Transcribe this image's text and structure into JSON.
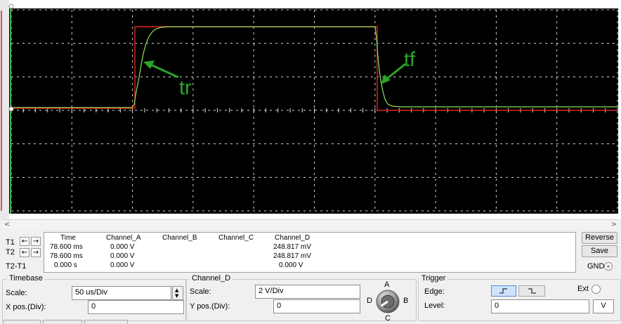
{
  "scope": {
    "annotations": {
      "rise": "tr",
      "fall": "tf"
    },
    "colors": {
      "grid": "#d8d8d8",
      "input_trace": "#e0241d",
      "output_trace": "#8ee05a",
      "arrow": "#2aa52a"
    }
  },
  "readout": {
    "row_labels": [
      "T1",
      "T2",
      "T2-T1"
    ],
    "headers": [
      "Time",
      "Channel_A",
      "Channel_B",
      "Channel_C",
      "Channel_D"
    ],
    "rows": [
      [
        "78.600 ms",
        "0.000 V",
        "",
        "",
        "248.817 mV"
      ],
      [
        "78.600 ms",
        "0.000 V",
        "",
        "",
        "248.817 mV"
      ],
      [
        "0.000 s",
        "0.000 V",
        "",
        "",
        "0.000 V"
      ]
    ]
  },
  "buttons": {
    "reverse": "Reverse",
    "save": "Save",
    "gnd": "GND"
  },
  "timebase": {
    "title": "Timebase",
    "scale_label": "Scale:",
    "scale_value": "50 us/Div",
    "xpos_label": "X pos.(Div):",
    "xpos_value": "0"
  },
  "channel": {
    "title": "Channel_D",
    "scale_label": "Scale:",
    "scale_value": "2  V/Div",
    "ypos_label": "Y pos.(Div):",
    "ypos_value": "0",
    "selector": {
      "top": "A",
      "left": "D",
      "right": "B",
      "bottom": "C"
    }
  },
  "trigger": {
    "title": "Trigger",
    "edge_label": "Edge:",
    "level_label": "Level:",
    "level_value": "0",
    "level_unit": "V",
    "ext_label": "Ext"
  }
}
